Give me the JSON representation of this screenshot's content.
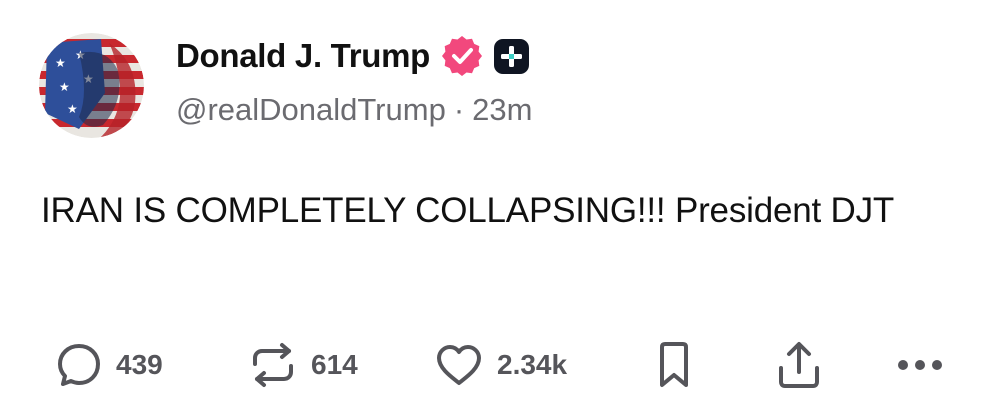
{
  "author": {
    "display_name": "Donald J. Trump",
    "handle": "@realDonaldTrump",
    "separator": "·",
    "time_ago": "23m",
    "verified_icon": "verified-badge-icon",
    "extra_badge_icon": "plus-badge-icon"
  },
  "post": {
    "text": "IRAN IS COMPLETELY COLLAPSING!!! President DJT"
  },
  "actions": {
    "reply_count": "439",
    "repost_count": "614",
    "like_count": "2.34k"
  },
  "colors": {
    "verified": "#f2487d",
    "text": "#111111",
    "muted": "#6b6b70",
    "icon": "#55555a"
  }
}
